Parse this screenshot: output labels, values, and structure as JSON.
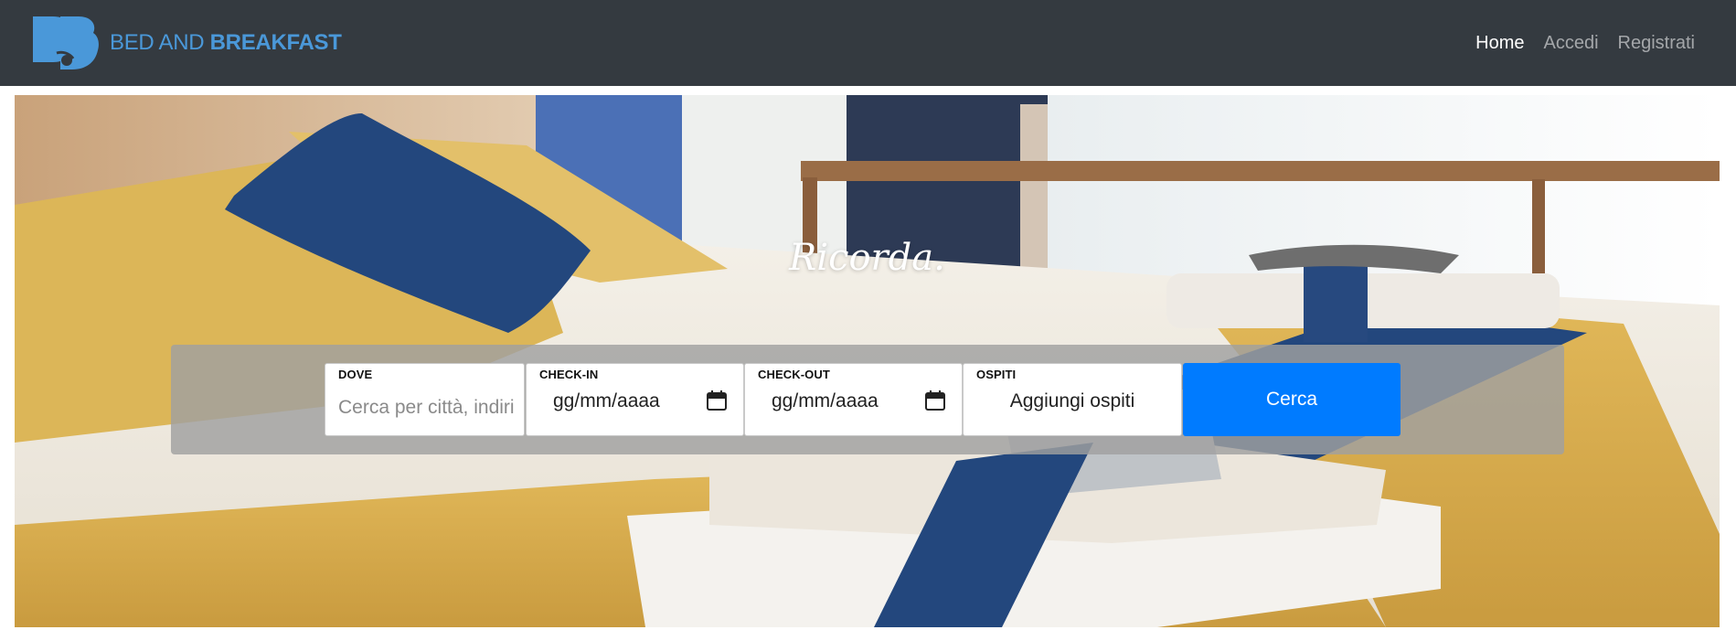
{
  "brand": {
    "name_light": "BED AND",
    "name_bold": "BREAKFAST",
    "logo_icon": "bb-logo-icon",
    "color": "#4a98d9"
  },
  "nav": {
    "background": "#343a40",
    "items": [
      {
        "label": "Home",
        "active": true
      },
      {
        "label": "Accedi",
        "active": false
      },
      {
        "label": "Registrati",
        "active": false
      }
    ]
  },
  "hero": {
    "title": "Ricorda.",
    "image": "hotel-room-bed-with-towels"
  },
  "search": {
    "where": {
      "label": "DOVE",
      "placeholder": "Cerca per città, indirizzo"
    },
    "checkin": {
      "label": "CHECK-IN",
      "value": "gg/mm/aaaa",
      "icon": "calendar-icon"
    },
    "checkout": {
      "label": "CHECK-OUT",
      "value": "gg/mm/aaaa",
      "icon": "calendar-icon"
    },
    "guests": {
      "label": "OSPITI",
      "value": "Aggiungi ospiti"
    },
    "submit_label": "Cerca",
    "submit_color": "#007bff"
  }
}
